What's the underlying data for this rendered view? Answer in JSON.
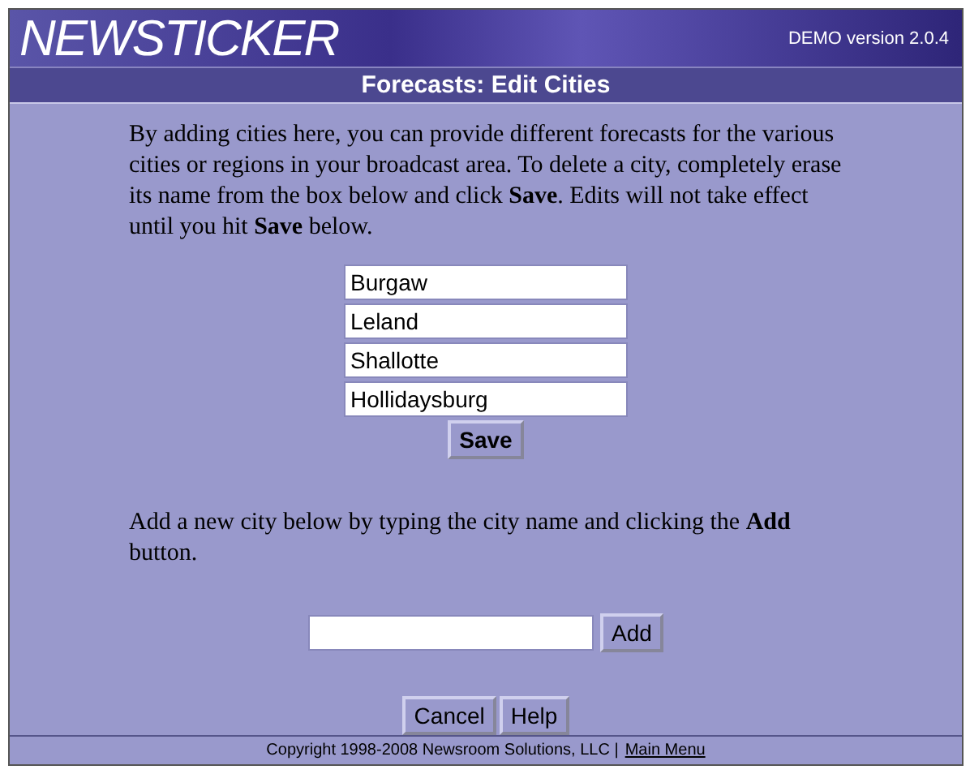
{
  "header": {
    "logo": "NEWSTICKER",
    "version": "DEMO version 2.0.4"
  },
  "title": "Forecasts: Edit Cities",
  "intro": "By adding cities here, you can provide different forecasts for the various cities or regions in your broadcast area. To delete a city, completely erase its name from the box below and click **Save**. Edits will not take effect until you hit **Save** below.",
  "cities": [
    {
      "value": "Burgaw"
    },
    {
      "value": "Leland"
    },
    {
      "value": "Shallotte"
    },
    {
      "value": "Hollidaysburg"
    }
  ],
  "save_button": "Save",
  "add_text": "Add a new city below by typing the city name and clicking the **Add** button.",
  "add_button": "Add",
  "buttons": [
    "Cancel",
    "Help"
  ],
  "footer": {
    "copyright": "Copyright 1998-2008 Newsroom Solutions, LLC |",
    "link": "Main Menu"
  }
}
